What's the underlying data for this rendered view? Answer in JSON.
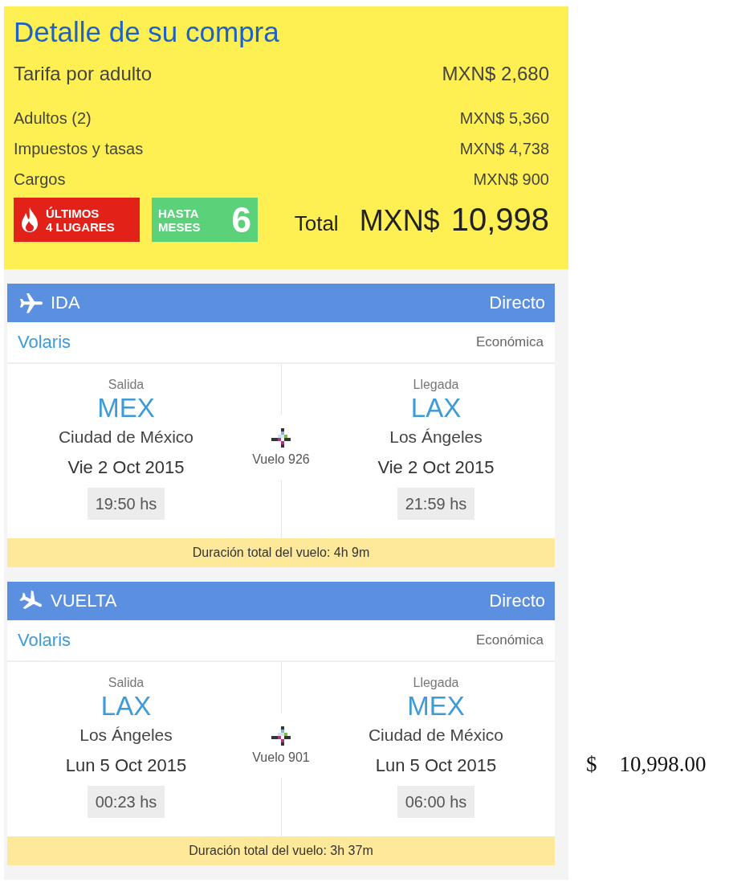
{
  "summary": {
    "title": "Detalle de su compra",
    "fare": {
      "label": "Tarifa por adulto",
      "value": "MXN$ 2,680"
    },
    "lines": [
      {
        "label": "Adultos (2)",
        "value": "MXN$ 5,360"
      },
      {
        "label": "Impuestos y tasas",
        "value": "MXN$ 4,738"
      },
      {
        "label": "Cargos",
        "value": "MXN$ 900"
      }
    ],
    "badges": [
      {
        "kind": "seats",
        "lines": [
          "ÚLTIMOS",
          "4 LUGARES"
        ]
      },
      {
        "kind": "installments",
        "lines": [
          "HASTA",
          "MESES"
        ],
        "number": "6"
      }
    ],
    "total": {
      "label": "Total",
      "currency": "MXN$",
      "amount": "10,998"
    }
  },
  "segments": [
    {
      "kind": "outbound",
      "title": "IDA",
      "type": "Directo",
      "airline": "Volaris",
      "cabin": "Económica",
      "departure": {
        "label": "Salida",
        "code": "MEX",
        "city": "Ciudad de México",
        "date": "Vie 2 Oct 2015",
        "time": "19:50 hs"
      },
      "flight": "Vuelo 926",
      "arrival": {
        "label": "Llegada",
        "code": "LAX",
        "city": "Los Ángeles",
        "date": "Vie 2 Oct 2015",
        "time": "21:59 hs"
      },
      "duration": "Duración total del vuelo: 4h 9m"
    },
    {
      "kind": "return",
      "title": "VUELTA",
      "type": "Directo",
      "airline": "Volaris",
      "cabin": "Económica",
      "departure": {
        "label": "Salida",
        "code": "LAX",
        "city": "Los Ángeles",
        "date": "Lun 5 Oct 2015",
        "time": "00:23 hs"
      },
      "flight": "Vuelo 901",
      "arrival": {
        "label": "Llegada",
        "code": "MEX",
        "city": "Ciudad de México",
        "date": "Lun 5 Oct 2015",
        "time": "06:00 hs"
      },
      "duration": "Duración total del vuelo: 3h 37m"
    }
  ],
  "side_amount": {
    "currency": "$",
    "amount": "10,998.00"
  }
}
